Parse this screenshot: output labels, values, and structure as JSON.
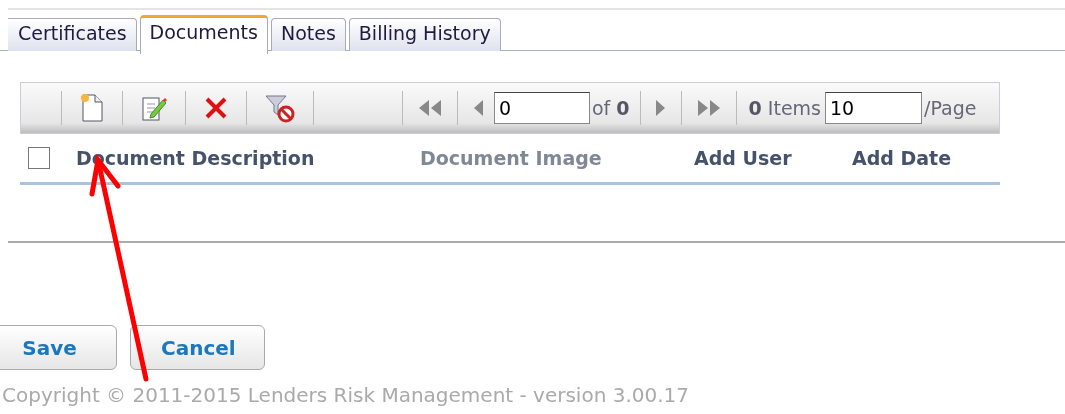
{
  "tabs": [
    {
      "label": "Certificates",
      "selected": false
    },
    {
      "label": "Documents",
      "selected": true
    },
    {
      "label": "Notes",
      "selected": false
    },
    {
      "label": "Billing History",
      "selected": false
    }
  ],
  "toolbar": {
    "actions": [
      {
        "kind": "new"
      },
      {
        "kind": "edit"
      },
      {
        "kind": "delete"
      },
      {
        "kind": "clear-filter"
      }
    ],
    "page_value": "0",
    "page_of": "of **0**",
    "items": "**0** Items",
    "page_size": "10",
    "per_page": "/Page"
  },
  "table": {
    "select_all_checked": false,
    "columns": [
      {
        "label": "Document Description",
        "dimmed": false
      },
      {
        "label": "Document Image",
        "dimmed": true
      },
      {
        "label": "Add User",
        "dimmed": false
      },
      {
        "label": "Add Date",
        "dimmed": false
      }
    ]
  },
  "buttons": [
    "Save",
    "Cancel"
  ],
  "footer": "Copyright © 2011-2015 Lenders Risk Management - version 3.00.17"
}
